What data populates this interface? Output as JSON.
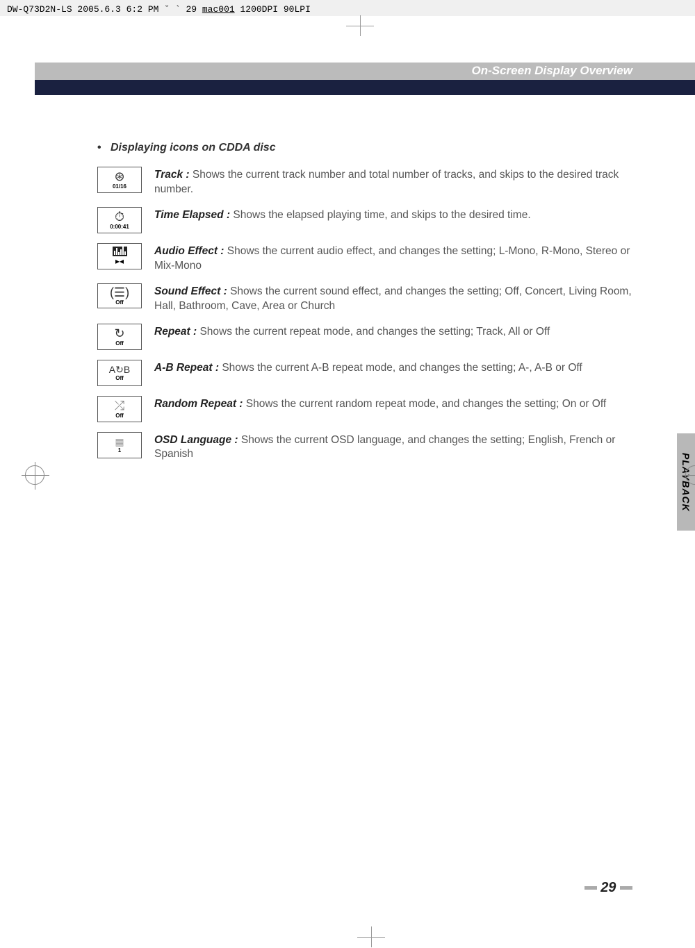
{
  "header": {
    "text_pre": "DW-Q73D2N-LS  2005.6.3 6:2 PM  ˘   ` 29   ",
    "text_mac": "mac001",
    "text_post": "  1200DPI 90LPI"
  },
  "banner": {
    "title": "On-Screen Display Overview"
  },
  "section_title": "Displaying icons on CDDA disc",
  "items": [
    {
      "icon_name": "track-icon",
      "icon_sub": "01/16",
      "term": "Track :",
      "desc": "  Shows the current track number and total number of tracks, and skips to the desired track number."
    },
    {
      "icon_name": "time-elapsed-icon",
      "icon_sub": "0:00:41",
      "term": "Time Elapsed  :",
      "desc": "  Shows the elapsed playing time, and skips to the desired time."
    },
    {
      "icon_name": "audio-effect-icon",
      "icon_sub": "",
      "term": "Audio Effect :",
      "desc": "  Shows the current audio effect, and changes the setting; L-Mono, R-Mono, Stereo or Mix-Mono"
    },
    {
      "icon_name": "sound-effect-icon",
      "icon_sub": "Off",
      "term": "Sound Effect :",
      "desc": "  Shows the current sound effect, and changes the setting; Off, Concert, Living Room, Hall, Bathroom, Cave, Area or Church"
    },
    {
      "icon_name": "repeat-icon",
      "icon_sub": "Off",
      "term": "Repeat :",
      "desc": "  Shows the current repeat mode, and changes the setting; Track, All or Off"
    },
    {
      "icon_name": "ab-repeat-icon",
      "icon_sub": "Off",
      "term": "A-B Repeat :",
      "desc": "  Shows the current A-B repeat mode, and changes the setting; A-, A-B or Off"
    },
    {
      "icon_name": "random-repeat-icon",
      "icon_sub": "Off",
      "term": "Random Repeat :",
      "desc": "  Shows the current random repeat mode, and changes the setting; On or Off"
    },
    {
      "icon_name": "osd-language-icon",
      "icon_sub": "1",
      "term": "OSD Language :",
      "desc": "  Shows the current OSD language, and changes the setting; English, French or Spanish"
    }
  ],
  "side_tab": "PLAYBACK",
  "page_number": "29"
}
